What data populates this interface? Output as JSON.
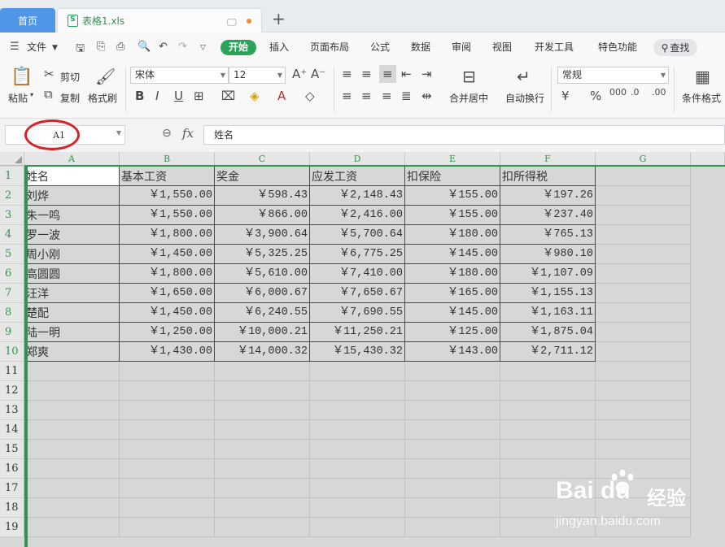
{
  "tabs": {
    "home_label": "首页",
    "file_label": "表格1.xls",
    "file_icon": "S",
    "add_label": "+"
  },
  "menu": {
    "file_label": "文件",
    "items": [
      "开始",
      "插入",
      "页面布局",
      "公式",
      "数据",
      "审阅",
      "视图",
      "开发工具",
      "特色功能"
    ],
    "search_label": "查找"
  },
  "ribbon": {
    "paste_label": "粘贴",
    "cut_label": "剪切",
    "copy_label": "复制",
    "format_painter_label": "格式刷",
    "font_name": "宋体",
    "font_size": "12",
    "number_format": "常规",
    "merge_label": "合并居中",
    "wrap_label": "自动换行",
    "conditional_label": "条件格式"
  },
  "formula": {
    "cell_ref": "A1",
    "fx_label": "fx",
    "content": "姓名"
  },
  "columns": [
    "A",
    "B",
    "C",
    "D",
    "E",
    "F",
    "G"
  ],
  "rows": [
    "1",
    "2",
    "3",
    "4",
    "5",
    "6",
    "7",
    "8",
    "9",
    "10",
    "11",
    "12",
    "13",
    "14",
    "15",
    "16",
    "17",
    "18",
    "19"
  ],
  "sheet": {
    "headers": [
      "姓名",
      "基本工资",
      "奖金",
      "应发工资",
      "扣保险",
      "扣所得税"
    ],
    "records": [
      [
        "刘烨",
        "￥1,550.00",
        "￥598.43",
        "￥2,148.43",
        "￥155.00",
        "￥197.26"
      ],
      [
        "朱一鸣",
        "￥1,550.00",
        "￥866.00",
        "￥2,416.00",
        "￥155.00",
        "￥237.40"
      ],
      [
        "罗一波",
        "￥1,800.00",
        "￥3,900.64",
        "￥5,700.64",
        "￥180.00",
        "￥765.13"
      ],
      [
        "周小刚",
        "￥1,450.00",
        "￥5,325.25",
        "￥6,775.25",
        "￥145.00",
        "￥980.10"
      ],
      [
        "高圆圆",
        "￥1,800.00",
        "￥5,610.00",
        "￥7,410.00",
        "￥180.00",
        "￥1,107.09"
      ],
      [
        "汪洋",
        "￥1,650.00",
        "￥6,000.67",
        "￥7,650.67",
        "￥165.00",
        "￥1,155.13"
      ],
      [
        "楚配",
        "￥1,450.00",
        "￥6,240.55",
        "￥7,690.55",
        "￥145.00",
        "￥1,163.11"
      ],
      [
        "陆一明",
        "￥1,250.00",
        "￥10,000.21",
        "￥11,250.21",
        "￥125.00",
        "￥1,875.04"
      ],
      [
        "郑爽",
        "￥1,430.00",
        "￥14,000.32",
        "￥15,430.32",
        "￥143.00",
        "￥2,711.12"
      ]
    ]
  },
  "watermark": {
    "brand": "Bai  du",
    "brand_cn": "经验",
    "url": "jingyan.baidu.com"
  },
  "colors": {
    "accent_green": "#2ba35a",
    "tab_blue": "#4f95e8",
    "annotation_red": "#d91f26"
  }
}
